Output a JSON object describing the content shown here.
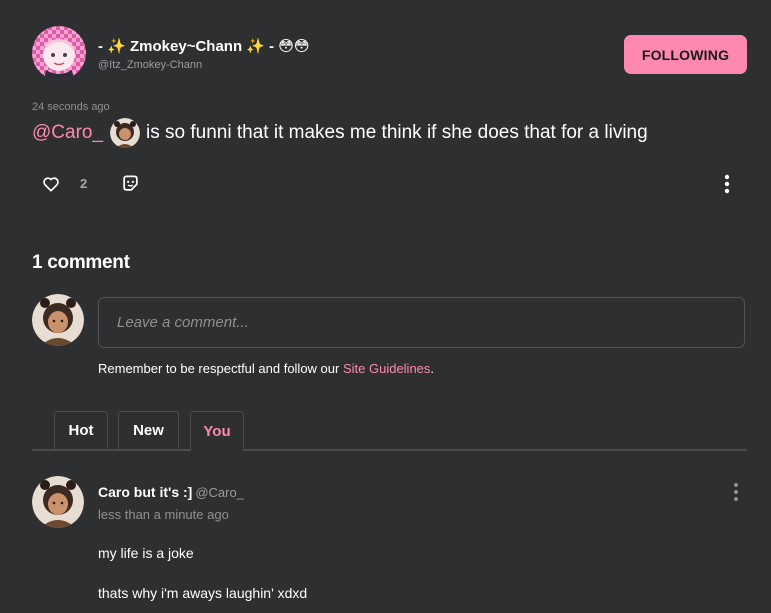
{
  "post": {
    "author": {
      "display_name": "- ✨ Zmokey~Chann ✨ - 😳😳",
      "handle": "@Itz_Zmokey-Chann"
    },
    "follow_button_label": "FOLLOWING",
    "timestamp": "24 seconds ago",
    "body": {
      "mention": "@Caro_",
      "text": "is so funni that it makes me think if she does that for a living"
    },
    "like_count": "2",
    "icons": {
      "like": "heart-outline-icon",
      "share": "share-sticker-icon",
      "more": "vertical-dots-icon"
    }
  },
  "comments_section": {
    "heading": "1 comment",
    "input_placeholder": "Leave a comment...",
    "guidelines_prefix": "Remember to be respectful and follow our ",
    "guidelines_link": "Site Guidelines",
    "guidelines_suffix": ".",
    "tabs": [
      {
        "label": "Hot",
        "active": false
      },
      {
        "label": "New",
        "active": false
      },
      {
        "label": "You",
        "active": true
      }
    ],
    "accent_color": "#ff88b1"
  },
  "comments": [
    {
      "display_name": "Caro but it's :]",
      "handle": "@Caro_",
      "time": "less than a minute ago",
      "lines": [
        "my life is a joke",
        "thats why i'm aways laughin' xdxd"
      ]
    }
  ]
}
